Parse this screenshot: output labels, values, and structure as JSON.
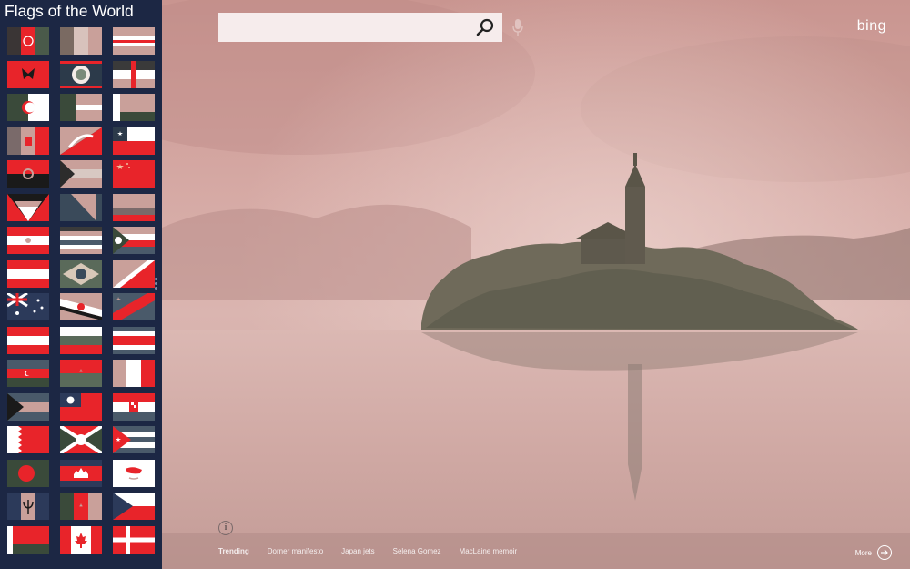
{
  "sidebar": {
    "title": "Flags of the World",
    "flags": [
      [
        "Afghanistan",
        "Albania-like (unknown)",
        "Cabo Verde-like"
      ],
      [
        "Albania",
        "Belize",
        "Austria-like"
      ],
      [
        "Algeria",
        "Latvia-like",
        "Belarus-like"
      ],
      [
        "Andorra",
        "Bhutan",
        "Chile"
      ],
      [
        "Angola",
        "Bahamas-like",
        "China"
      ],
      [
        "Antigua and Barbuda",
        "Bosnia and Herzegovina",
        "Colombia-like"
      ],
      [
        "Armenia-like",
        "Bolivia-like",
        "Comoros"
      ],
      [
        "Austria",
        "Brazil",
        "Congo"
      ],
      [
        "Australia",
        "Brunei",
        "Democratic Republic of the Congo"
      ],
      [
        "Austria",
        "Bulgaria",
        "Costa Rica"
      ],
      [
        "Azerbaijan",
        "Burkina Faso",
        "Côte d'Ivoire"
      ],
      [
        "Bahamas",
        "Taiwan",
        "Croatia"
      ],
      [
        "Bahrain",
        "Burundi",
        "Cuba"
      ],
      [
        "Bangladesh",
        "Cambodia",
        "Cyprus"
      ],
      [
        "Barbados",
        "Cameroon",
        "Czech Republic"
      ],
      [
        "Belarus",
        "Canada",
        "Denmark"
      ]
    ]
  },
  "search": {
    "placeholder": "",
    "value": ""
  },
  "brand": {
    "logo_text": "bing"
  },
  "info": {
    "glyph": "i"
  },
  "trending": {
    "label": "Trending",
    "items": [
      "Dorner manifesto",
      "Japan jets",
      "Selena Gomez",
      "MacLaine memoir"
    ]
  },
  "more": {
    "label": "More"
  },
  "colors": {
    "sidebar_bg": "#1c2744",
    "flag_red": "#e8242a",
    "flag_muted": "#c9a09a",
    "flag_dark": "#3a4a3a",
    "sky_tint": "#d9a9a4"
  }
}
